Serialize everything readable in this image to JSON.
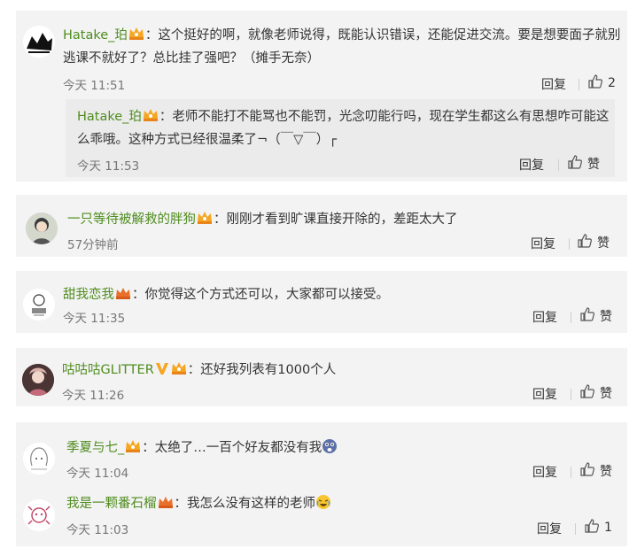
{
  "comments": [
    {
      "username": "Hatake_珀",
      "text_line1": "这个挺好的啊，就像老师说得，既能认识错误，还能促进交流。要是想要面子就别",
      "text_line2": "逃课不就好了？总比挂了强吧？（摊手无奈）",
      "time": "今天 11:51",
      "reply_label": "回复",
      "like_count": "2",
      "sub_reply": {
        "username": "Hatake_珀",
        "text_line1": "老师不能打不能骂也不能罚，光念叨能行吗，现在学生都这么有思想咋可能这",
        "text_line2": "么乖哦。这种方式已经很温柔了¬（￣▽￣）┌",
        "time": "今天 11:53",
        "reply_label": "回复",
        "like_label": "赞"
      }
    },
    {
      "username": "一只等待被解救的胖狗",
      "text": "刚刚才看到旷课直接开除的，差距太大了",
      "time": "57分钟前",
      "reply_label": "回复",
      "like_label": "赞"
    },
    {
      "username": "甜我恋我",
      "text": "你觉得这个方式还可以，大家都可以接受。",
      "time": "今天 11:35",
      "reply_label": "回复",
      "like_label": "赞"
    },
    {
      "username": "咕咕咕GLITTER",
      "text": "还好我列表有1000个人",
      "time": "今天 11:26",
      "reply_label": "回复",
      "like_label": "赞"
    },
    {
      "username": "季夏与七_",
      "text": "太绝了…一百个好友都没有我",
      "time": "今天 11:04",
      "reply_label": "回复",
      "like_label": "赞"
    },
    {
      "username": "我是一颗番石榴",
      "text": "我怎么没有这样的老师",
      "time": "今天 11:03",
      "reply_label": "回复",
      "like_count": "1"
    }
  ],
  "colon": "：",
  "colors": {
    "username": "#4f8c1f",
    "card_bg": "#f3f3f3",
    "subcard_bg": "#ebebeb",
    "badge": "#f5a623"
  },
  "icons": [
    "crown-badge-icon",
    "v-badge-icon",
    "thumb-up-icon",
    "scared-emoji-icon",
    "crying-laugh-emoji-icon"
  ]
}
